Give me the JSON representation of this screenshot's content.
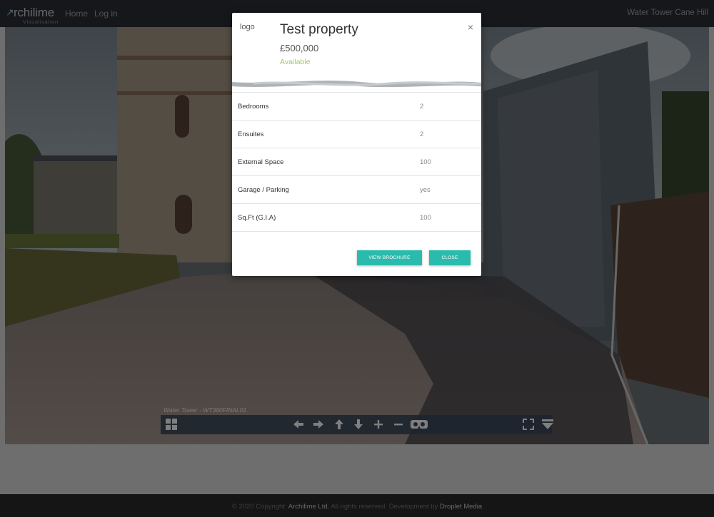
{
  "header": {
    "logo_text": "rchilime",
    "logo_sub": "Visualisation",
    "nav": [
      {
        "label": "Home"
      },
      {
        "label": "Log in"
      }
    ],
    "site_title": "Water Tower Cane Hill"
  },
  "viewer": {
    "scene_title": "Water Tower - WT360FINAL01",
    "toolbar_icons": [
      "thumbnails-icon",
      "arrow-left-icon",
      "arrow-right-icon",
      "arrow-up-icon",
      "arrow-down-icon",
      "zoom-in-icon",
      "zoom-out-icon",
      "vr-icon",
      "fullscreen-icon",
      "hide-toolbar-icon"
    ]
  },
  "modal": {
    "logo": "logo",
    "title": "Test property",
    "price": "£500,000",
    "status": "Available",
    "close_symbol": "×",
    "details": [
      {
        "label": "Bedrooms",
        "value": "2"
      },
      {
        "label": "Ensuites",
        "value": "2"
      },
      {
        "label": "External Space",
        "value": "100"
      },
      {
        "label": "Garage / Parking",
        "value": "yes"
      },
      {
        "label": "Sq.Ft (G.I.A)",
        "value": "100"
      }
    ],
    "buttons": {
      "brochure": "VIEW BROCHURE",
      "close": "CLOSE"
    }
  },
  "footer": {
    "copyright": "© 2020 Copyright:",
    "company": "Archilime Ltd.",
    "rights": "All rights reserved. Development by",
    "developer": "Droplet Media"
  },
  "colors": {
    "topbar": "#2c2f36",
    "accent_button": "#2bbbad",
    "status_available": "#9ccc64",
    "toolbar": "#3c4a5c"
  }
}
